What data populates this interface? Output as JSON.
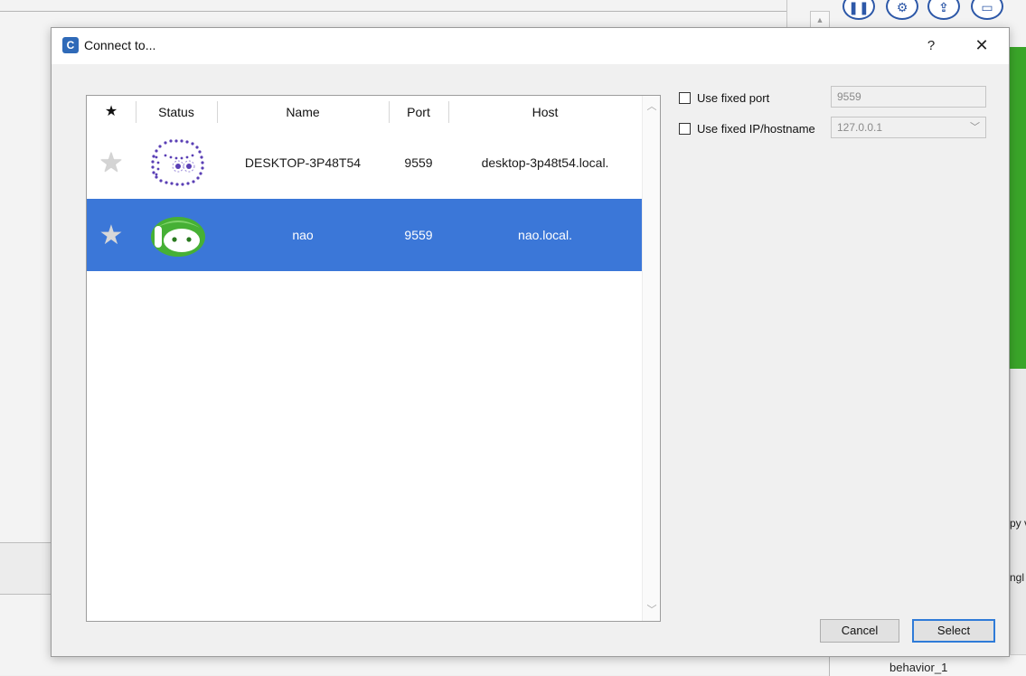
{
  "dialog": {
    "icon_letter": "C",
    "title": "Connect to...",
    "help_label": "?",
    "close_label": "✕"
  },
  "table": {
    "headers": {
      "favorite": "★",
      "status": "Status",
      "name": "Name",
      "port": "Port",
      "host": "Host"
    },
    "rows": [
      {
        "favorite": "★",
        "status_icon": "robot-offline-icon",
        "name": "DESKTOP-3P48T54",
        "port": "9559",
        "host": "desktop-3p48t54.local.",
        "selected": false
      },
      {
        "favorite": "★",
        "status_icon": "robot-online-icon",
        "name": "nao",
        "port": "9559",
        "host": "nao.local.",
        "selected": true
      }
    ]
  },
  "options": {
    "fixed_port_label": "Use fixed port",
    "fixed_port_value": "9559",
    "fixed_ip_label": "Use fixed IP/hostname",
    "fixed_ip_value": "127.0.0.1"
  },
  "buttons": {
    "cancel": "Cancel",
    "select": "Select"
  },
  "background": {
    "right_text_1": "py v",
    "right_text_2": "ngl",
    "bottom_text": "behavior_1"
  },
  "colors": {
    "selection": "#3b77d8",
    "robot_green": "#3aa529",
    "offline_purple": "#5a3fb5",
    "accent": "#2f7bd8"
  }
}
